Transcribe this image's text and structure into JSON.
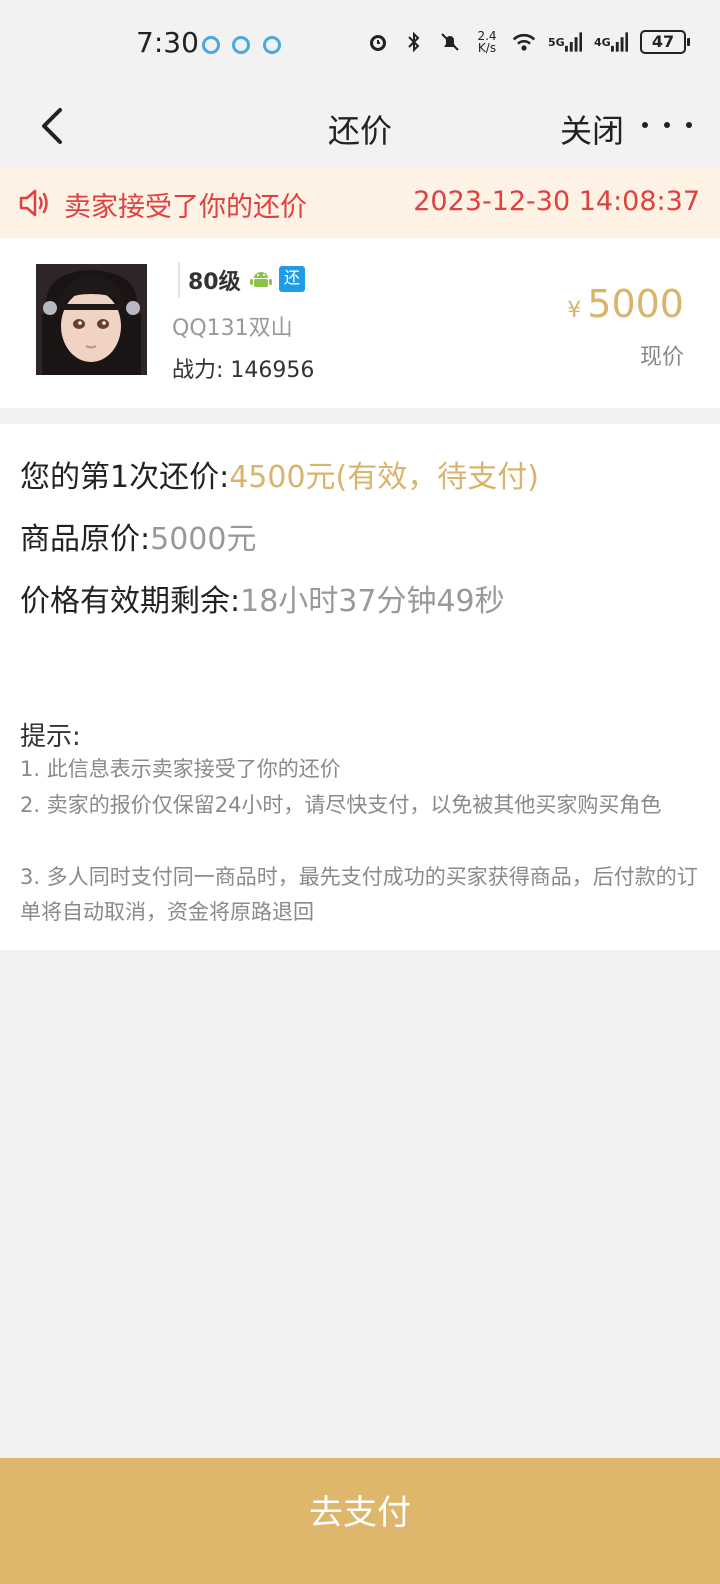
{
  "status_bar": {
    "time": "7:30",
    "net_speed_value": "2.4",
    "net_speed_unit": "K/s",
    "signal_1": "5G",
    "signal_2": "4G",
    "battery": "47"
  },
  "nav": {
    "title": "还价",
    "close_label": "关闭"
  },
  "notice": {
    "text": "卖家接受了你的还价",
    "timestamp": "2023-12-30 14:08:37",
    "color": "#e04040"
  },
  "product": {
    "level": "80级",
    "tag": "还",
    "seller": "QQ131双山",
    "power": "战力: 146956",
    "currency": "¥",
    "price": "5000",
    "price_label": "现价"
  },
  "details": {
    "counter_label": "您的第1次还价:",
    "counter_value": "4500元(有效，待支付)",
    "original_label": "商品原价:",
    "original_value": "5000元",
    "remaining_label": "价格有效期剩余:",
    "remaining_value": "18小时37分钟49秒"
  },
  "tips": {
    "title": "提示:",
    "items": [
      "1. 此信息表示卖家接受了你的还价",
      "2. 卖家的报价仅保留24小时，请尽快支付，以免被其他买家购买角色",
      "3. 多人同时支付同一商品时，最先支付成功的买家获得商品，后付款的订单将自动取消，资金将原路退回"
    ]
  },
  "pay_button": {
    "label": "去支付",
    "color": "#dfb76c"
  },
  "accent_gold": "#d9b46a"
}
